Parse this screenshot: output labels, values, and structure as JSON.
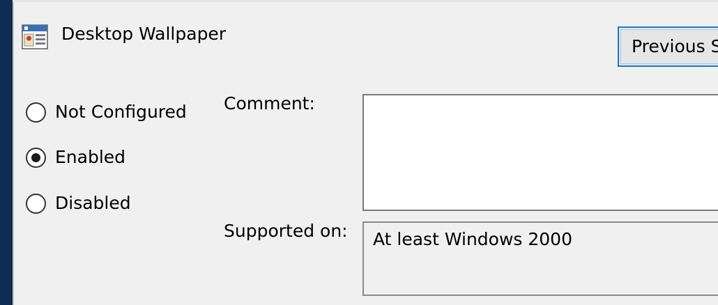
{
  "header": {
    "icon": "policy-setting-icon",
    "title": "Desktop Wallpaper"
  },
  "navigation": {
    "previous_label": "Previous S"
  },
  "state_options": [
    {
      "label": "Not Configured",
      "checked": false
    },
    {
      "label": "Enabled",
      "checked": true
    },
    {
      "label": "Disabled",
      "checked": false
    }
  ],
  "comment": {
    "label": "Comment:",
    "value": ""
  },
  "supported_on": {
    "label": "Supported on:",
    "value": "At least Windows 2000"
  },
  "colors": {
    "background": "#f0f0f0",
    "focus_border": "#1b76d2",
    "window_edge": "#0d2e52"
  }
}
